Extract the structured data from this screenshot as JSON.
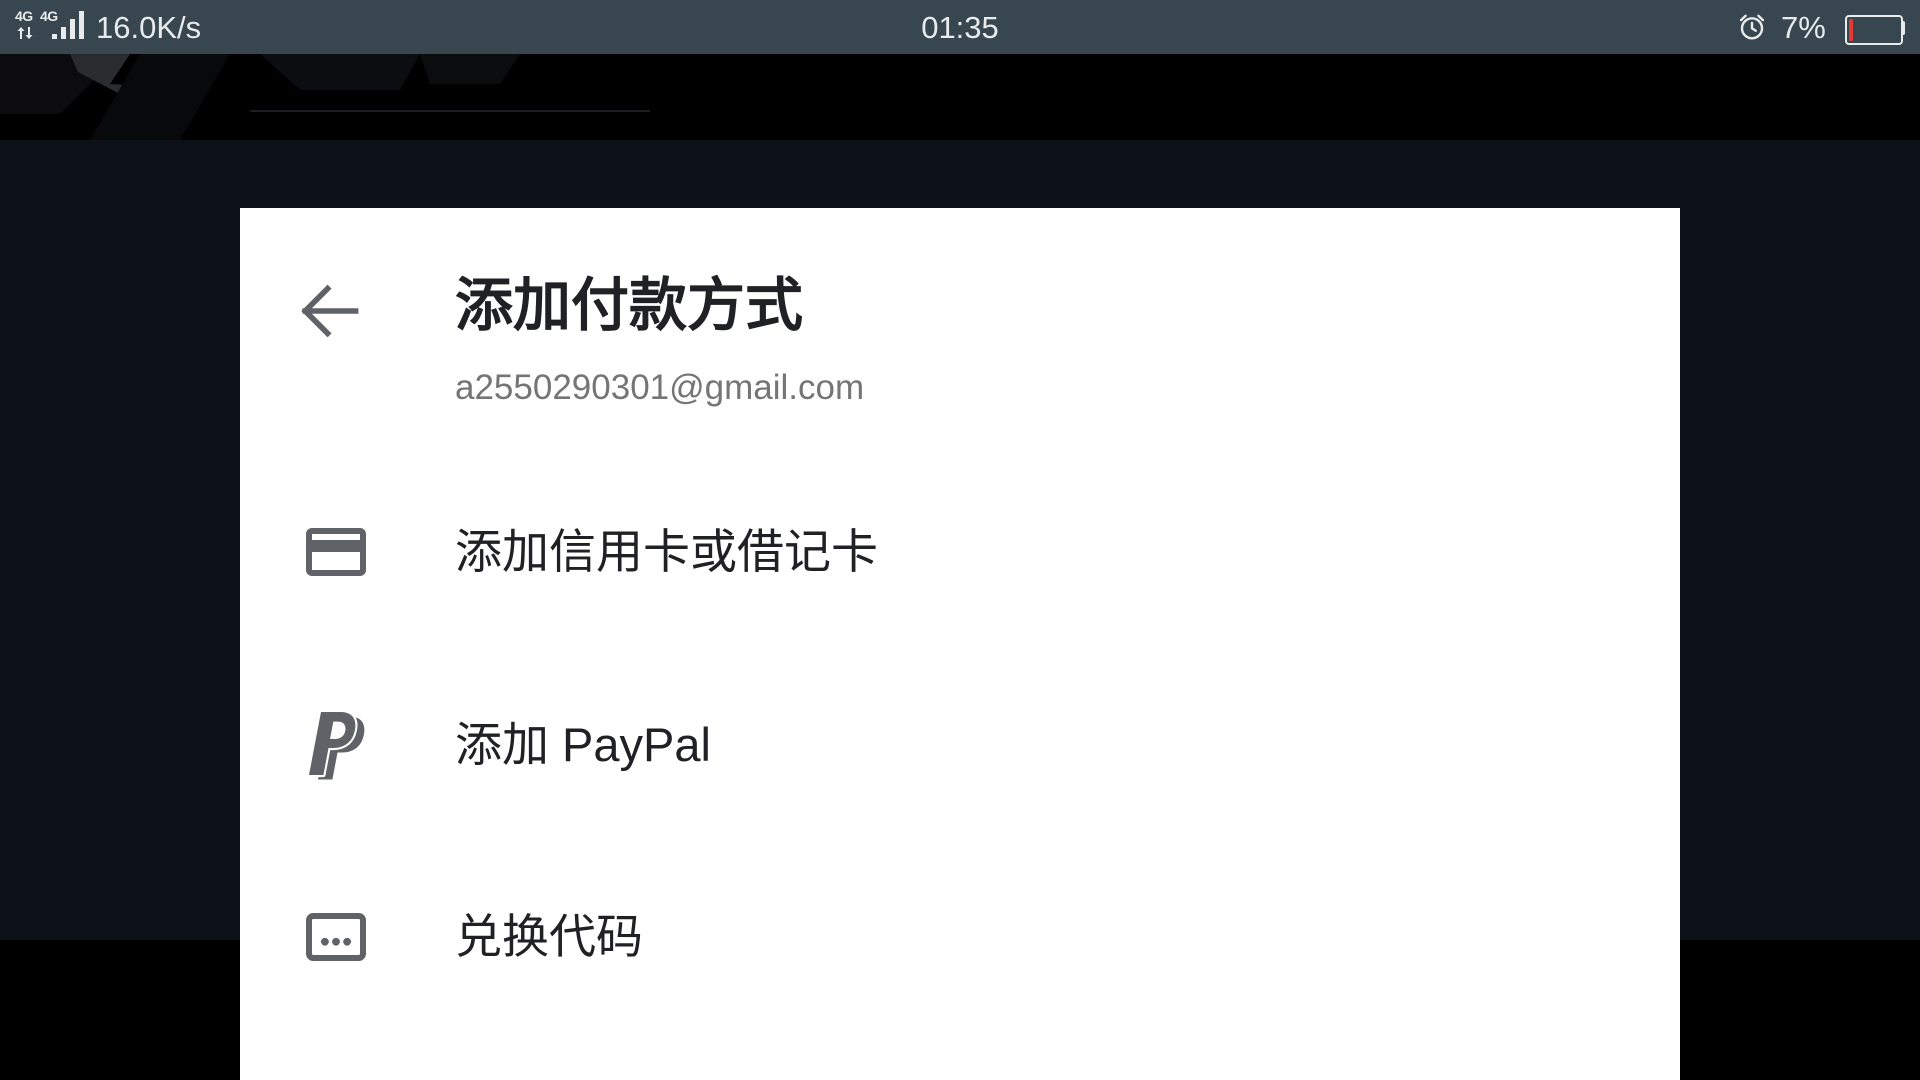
{
  "status_bar": {
    "network_labels": [
      "4G",
      "4G"
    ],
    "net_speed": "16.0K/s",
    "time": "01:35",
    "battery_text": "7%",
    "battery_level": 0.07,
    "icons": [
      "data-activity-icon",
      "signal-strength-icon",
      "alarm-icon",
      "battery-icon"
    ]
  },
  "dialog": {
    "back_icon": "arrow-back-icon",
    "title": "添加付款方式",
    "account_email": "a2550290301@gmail.com",
    "options": [
      {
        "label": "添加信用卡或借记卡",
        "icon": "credit-card-icon"
      },
      {
        "label": "添加 PayPal",
        "icon": "paypal-icon"
      },
      {
        "label": "兑换代码",
        "icon": "redeem-code-icon"
      }
    ]
  },
  "colors": {
    "status_bar_bg": "#38474f",
    "status_bar_text": "#e8eaeb",
    "backdrop": "#0b1116",
    "dialog_bg": "#ffffff",
    "title_text": "#202124",
    "secondary_text": "#757575",
    "icon": "#5f6368",
    "battery_low": "#e53935"
  }
}
